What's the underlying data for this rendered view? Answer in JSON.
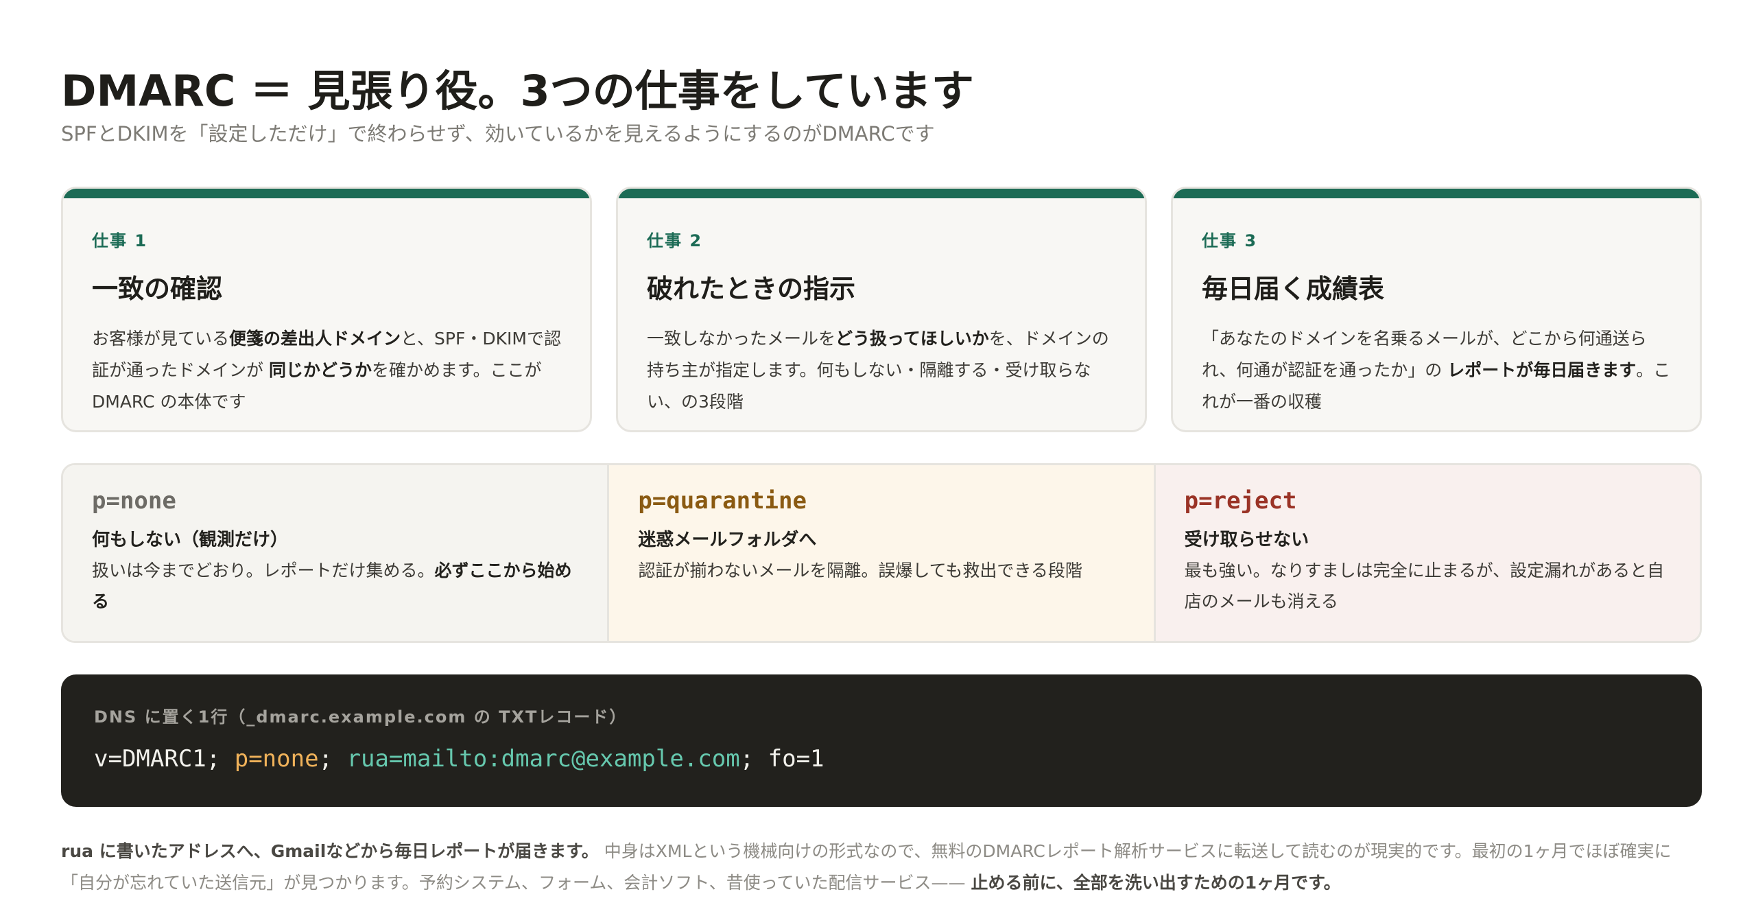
{
  "header": {
    "title": "DMARC ＝ 見張り役。3つの仕事をしています",
    "subtitle": "SPFとDKIMを「設定しただけ」で終わらせず、効いているかを見えるようにするのがDMARCです"
  },
  "cards": [
    {
      "kicker": "仕事 1",
      "title": "一致の確認",
      "body_1": "お客様が見ている",
      "body_bold_1": "便箋の差出人ドメイン",
      "body_2": "と、SPF・DKIMで認証が通ったドメインが ",
      "body_bold_2": "同じかどうか",
      "body_3": "を確かめます。ここが DMARC の本体です"
    },
    {
      "kicker": "仕事 2",
      "title": "破れたときの指示",
      "body_1": "一致しなかったメールを",
      "body_bold_1": "どう扱ってほしいか",
      "body_2": "を、ドメインの持ち主が指定します。何もしない・隔離する・受け取らない、の3段階",
      "body_bold_2": "",
      "body_3": ""
    },
    {
      "kicker": "仕事 3",
      "title": "毎日届く成績表",
      "body_1": "「あなたのドメインを名乗るメールが、どこから何通送られ、何通が認証を通ったか」の ",
      "body_bold_1": "レポートが毎日届きます",
      "body_2": "。これが一番の収穫",
      "body_bold_2": "",
      "body_3": ""
    }
  ],
  "policies": [
    {
      "code": "p=none",
      "heading": "何もしない（観測だけ）",
      "desc": "扱いは今までどおり。レポートだけ集める。",
      "desc_bold": "必ずここから始める"
    },
    {
      "code": "p=quarantine",
      "heading": "迷惑メールフォルダへ",
      "desc": "認証が揃わないメールを隔離。誤爆しても救出できる段階",
      "desc_bold": ""
    },
    {
      "code": "p=reject",
      "heading": "受け取らせない",
      "desc": "最も強い。なりすましは完全に止まるが、設定漏れがあると自店のメールも消える",
      "desc_bold": ""
    }
  ],
  "dns": {
    "label": "DNS に置く1行（_dmarc.example.com の TXTレコード）",
    "part_version": "v=DMARC1;",
    "part_policy": "p=none",
    "sep_1": ";",
    "part_rua": "rua=mailto:dmarc@example.com",
    "sep_2": ";",
    "part_fo": "fo=1"
  },
  "footnote": {
    "bold_1": "rua に書いたアドレスへ、Gmailなどから毎日レポートが届きます。",
    "text_1": " 中身はXMLという機械向けの形式なので、無料のDMARCレポート解析サービスに転送して読むのが現実的です。最初の1ヶ月でほぼ確実に「自分が忘れていた送信元」が見つかります。予約システム、フォーム、会計ソフト、昔使っていた配信サービス—— ",
    "bold_2": "止める前に、全部を洗い出すための1ヶ月です。"
  }
}
